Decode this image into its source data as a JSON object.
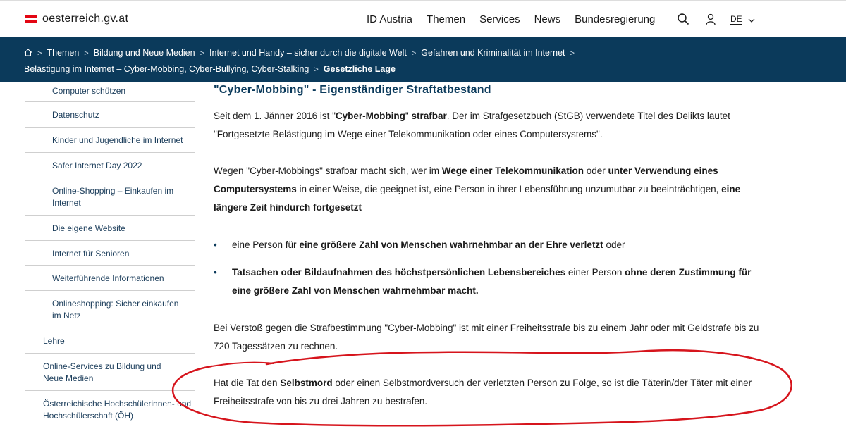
{
  "header": {
    "site_name": "oesterreich.gv.at",
    "flag_colors": [
      "#e30613",
      "#ffffff",
      "#e30613"
    ],
    "nav": [
      "ID Austria",
      "Themen",
      "Services",
      "News",
      "Bundesregierung"
    ],
    "icons": [
      "search-icon",
      "user-icon",
      "chevron-down-icon"
    ],
    "language": "DE"
  },
  "breadcrumb": {
    "items": [
      "Themen",
      "Bildung und Neue Medien",
      "Internet und Handy – sicher durch die digitale Welt",
      "Gefahren und Kriminalität im Internet",
      "Belästigung im Internet – Cyber-Mobbing, Cyber-Bullying, Cyber-Stalking"
    ],
    "current": "Gesetzliche Lage"
  },
  "sidebar": {
    "items": [
      {
        "label": "Computer schützen"
      },
      {
        "label": "Datenschutz"
      },
      {
        "label": "Kinder und Jugendliche im Internet"
      },
      {
        "label": "Safer Internet Day 2022"
      },
      {
        "label": "Online-Shopping – Einkaufen im Internet"
      },
      {
        "label": "Die eigene Website"
      },
      {
        "label": "Internet für Senioren"
      },
      {
        "label": "Weiterführende Informationen"
      },
      {
        "label": "Onlineshopping: Sicher einkaufen im Netz"
      },
      {
        "label": "Lehre"
      },
      {
        "label": "Online-Services zu Bildung und Neue Medien"
      },
      {
        "label": "Österreichische Hochschülerinnen- und Hochschülerschaft (ÖH)"
      }
    ]
  },
  "main": {
    "heading": "\"Cyber-Mobbing\" - Eigenständiger Straftatbestand",
    "p1": {
      "a": "Seit dem 1. Jänner 2016 ist \"",
      "b": "Cyber-Mobbing",
      "c": "\" ",
      "d": "strafbar",
      "e": ". Der im Strafgesetzbuch (StGB) verwendete Titel des Delikts lautet \"Fortgesetzte Belästigung im Wege einer Telekommunikation oder eines Computersystems\"."
    },
    "p2": {
      "a": "Wegen \"Cyber-Mobbings\" strafbar macht sich, wer im ",
      "b": "Wege einer Telekommunikation",
      "c": " oder ",
      "d": "unter Verwendung eines Computersystems",
      "e": " in einer Weise, die geeignet ist, eine Person in ihrer Lebensführung unzumutbar zu beeinträchtigen, ",
      "f": "eine längere Zeit hindurch fortgesetzt"
    },
    "bullet1": {
      "a": "eine Person für ",
      "b": "eine größere Zahl von Menschen wahrnehmbar an der Ehre verletzt",
      "c": " oder"
    },
    "bullet2": {
      "a": "Tatsachen oder Bildaufnahmen des höchstpersönlichen Lebensbereiches",
      "b": " einer Person ",
      "c": "ohne deren Zustimmung für eine größere Zahl von Menschen wahrnehmbar macht."
    },
    "bullet_symbol": "•",
    "p3": "Bei Verstoß gegen die Strafbestimmung \"Cyber-Mobbing\" ist mit einer Freiheitsstrafe bis zu einem Jahr oder mit Geldstrafe bis zu 720 Tagessätzen zu rechnen.",
    "p4": {
      "a": "Hat die Tat den ",
      "b": "Selbstmord",
      "c": " oder einen Selbstmordversuch der verletzten Person zu Folge, so ist die Täterin/der Täter mit einer Freiheitsstrafe von bis zu drei Jahren zu bestrafen."
    }
  },
  "annotation_color": "#d6141c",
  "colors": {
    "brand_dark": "#0b3a5b",
    "link": "#1a3c5a"
  }
}
